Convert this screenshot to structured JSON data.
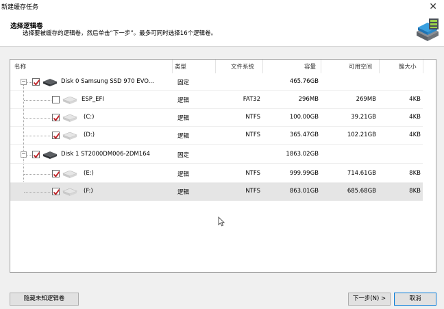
{
  "window": {
    "title": "新建缓存任务",
    "close_glyph": "✕"
  },
  "header": {
    "title": "选择逻辑卷",
    "description": "选择要被缓存的逻辑卷，然后单击“下一步”。最多可同时选择16个逻辑卷。"
  },
  "columns": [
    "名称",
    "类型",
    "文件系统",
    "容量",
    "可用空间",
    "簇大小"
  ],
  "rows": [
    {
      "level": 0,
      "name": "Disk 0 Samsung SSD 970 EVO...",
      "type": "固定",
      "fs": "",
      "capacity": "465.76GB",
      "free": "",
      "cluster": "",
      "checked": true,
      "expander": "−"
    },
    {
      "level": 1,
      "name": "ESP_EFI",
      "type": "逻辑",
      "fs": "FAT32",
      "capacity": "296MB",
      "free": "269MB",
      "cluster": "4KB",
      "checked": false
    },
    {
      "level": 1,
      "name": "(C:)",
      "type": "逻辑",
      "fs": "NTFS",
      "capacity": "100.00GB",
      "free": "39.21GB",
      "cluster": "4KB",
      "checked": true
    },
    {
      "level": 1,
      "name": "(D:)",
      "type": "逻辑",
      "fs": "NTFS",
      "capacity": "365.47GB",
      "free": "102.21GB",
      "cluster": "4KB",
      "checked": true
    },
    {
      "level": 0,
      "name": "Disk 1 ST2000DM006-2DM164",
      "type": "固定",
      "fs": "",
      "capacity": "1863.02GB",
      "free": "",
      "cluster": "",
      "checked": true,
      "expander": "−"
    },
    {
      "level": 1,
      "name": "(E:)",
      "type": "逻辑",
      "fs": "NTFS",
      "capacity": "999.99GB",
      "free": "714.61GB",
      "cluster": "8KB",
      "checked": true
    },
    {
      "level": 1,
      "name": "(F:)",
      "type": "逻辑",
      "fs": "NTFS",
      "capacity": "863.01GB",
      "free": "685.68GB",
      "cluster": "8KB",
      "checked": true,
      "selected": true
    }
  ],
  "buttons": {
    "hide_unknown": "隐藏未知逻辑卷",
    "next": "下一步(N) >",
    "cancel": "取消"
  },
  "icons": {
    "title_icon": "disk-cache-icon",
    "close": "close-icon",
    "disk": "hard-disk-icon",
    "volume": "volume-icon",
    "cursor": "mouse-pointer-icon"
  },
  "colors": {
    "check_mark": "#c0282d",
    "selected_row": "#e5e5e5",
    "default_button_border": "#0078d7"
  }
}
